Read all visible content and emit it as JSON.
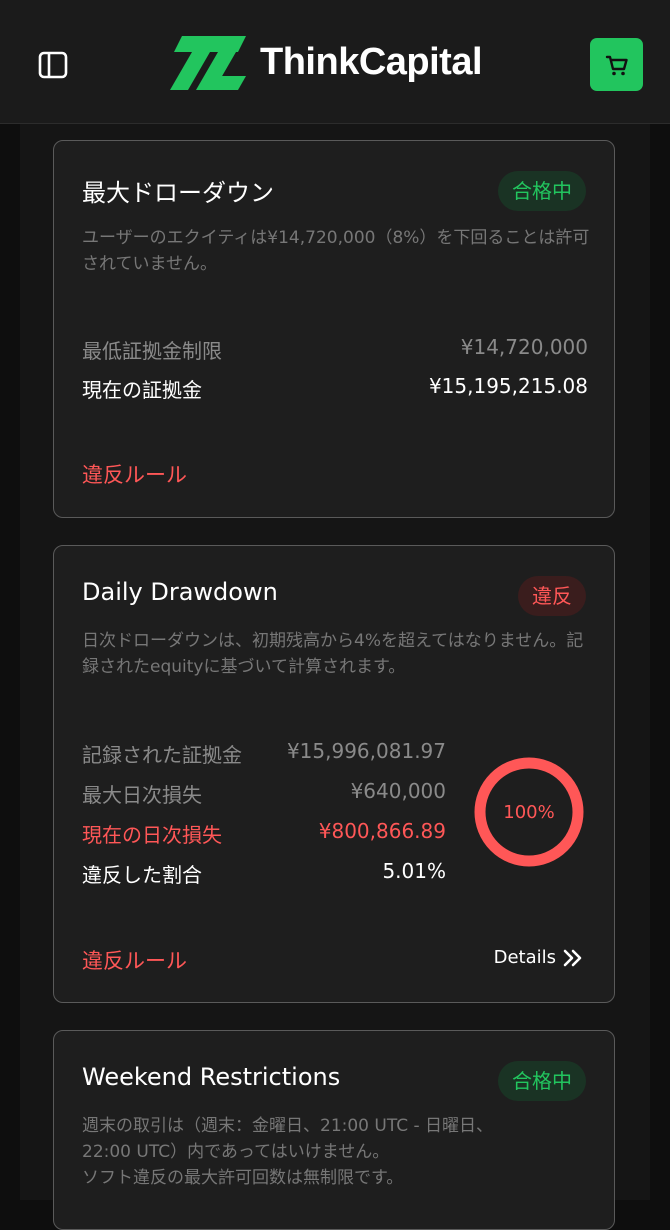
{
  "header": {
    "brand": "ThinkCapital",
    "accent_color": "#22c55e"
  },
  "max_drawdown": {
    "title": "最大ドローダウン",
    "status": "合格中",
    "description": "ユーザーのエクイティは¥14,720,000（8%）を下回ることは許可されていません。",
    "min_margin_label": "最低証拠金制限",
    "min_margin_value": "¥14,720,000",
    "current_margin_label": "現在の証拠金",
    "current_margin_value": "¥15,195,215.08",
    "rules_link": "違反ルール"
  },
  "daily_drawdown": {
    "title": "Daily Drawdown",
    "status": "違反",
    "description": "日次ドローダウンは、初期残高から4%を超えてはなりません。記録されたequityに基づいて計算されます。",
    "recorded_margin_label": "記録された証拠金",
    "recorded_margin_value": "¥15,996,081.97",
    "max_daily_loss_label": "最大日次損失",
    "max_daily_loss_value": "¥640,000",
    "current_daily_loss_label": "現在の日次損失",
    "current_daily_loss_value": "¥800,866.89",
    "breach_ratio_label": "違反した割合",
    "breach_ratio_value": "5.01%",
    "progress_label": "100%",
    "progress_fraction": 1.0,
    "rules_link": "違反ルール",
    "details_label": "Details"
  },
  "weekend": {
    "title": "Weekend Restrictions",
    "status": "合格中",
    "description_line1": "週末の取引は（週末：金曜日、21:00 UTC - 日曜日、",
    "description_line2": "22:00 UTC）内であってはいけません。",
    "description_line3": "ソフト違反の最大許可回数は無制限です。"
  }
}
